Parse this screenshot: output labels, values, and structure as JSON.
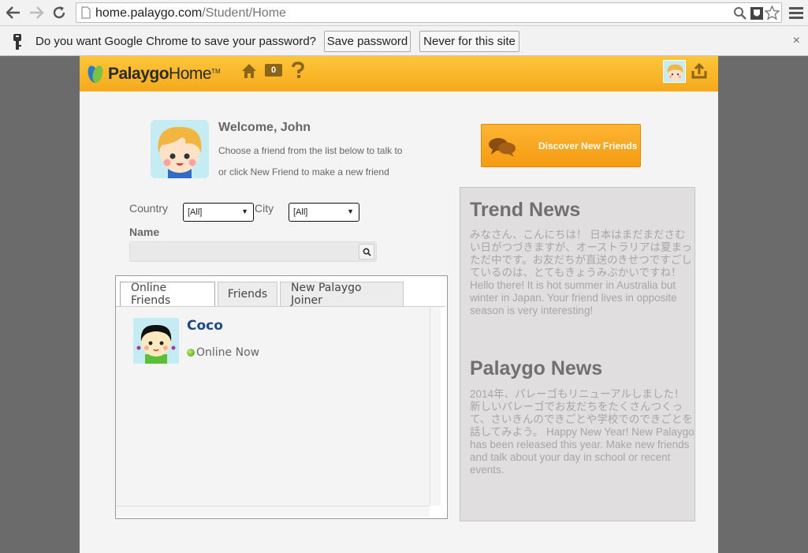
{
  "browser": {
    "url_host": "home.palaygo.com",
    "url_path": "/Student/Home"
  },
  "infobar": {
    "message": "Do you want Google Chrome to save your password?",
    "save_label": "Save password",
    "never_label": "Never for this site",
    "close_label": "×"
  },
  "header": {
    "brand_bold": "Palaygo",
    "brand_light": "Home",
    "trademark": "TM",
    "mail_count": "0"
  },
  "welcome": {
    "title": "Welcome, John",
    "line1": "Choose a friend from the list below to talk to",
    "line2": "or click New Friend to make a new friend"
  },
  "discover_label": "Discover New Friends",
  "filters": {
    "country_label": "Country",
    "country_value": "[All]",
    "city_label": "City",
    "city_value": "[All]",
    "name_label": "Name"
  },
  "tabs": [
    {
      "label": "Online Friends"
    },
    {
      "label": "Friends"
    },
    {
      "label": "New Palaygo Joiner"
    }
  ],
  "friend": {
    "name": "Coco",
    "status": "Online Now"
  },
  "news": {
    "trend_title": "Trend News",
    "trend_body": "みなさん、こんにちは！ 日本はまだまださむい日がつづきますが、オーストラリアは夏まっただ中です。お友だちが直送のきせつですごしているのは、とてもきょうみぶかいですね！ Hello there! It is hot summer in Australia but winter in Japan. Your friend lives in opposite season is very interesting!",
    "palaygo_title": "Palaygo News",
    "palaygo_body": "2014年、パレーゴもリニューアルしました！ 新しいパレーゴでお友だちをたくさんつくって、さいきんのできごとや学校でのできごとを話してみよう。 Happy New Year! New Palaygo has been released this year. Make new friends and talk about your day in school or recent events."
  },
  "colors": {
    "header": "#f8b42a",
    "discover": "#f7a21c",
    "friend_name": "#1b4a86"
  }
}
